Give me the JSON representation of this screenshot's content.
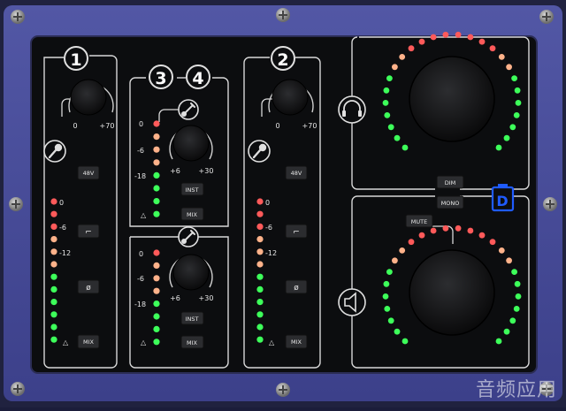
{
  "colors": {
    "chassis": "#4a4f9a",
    "panel": "#0c0d0f",
    "line": "#d8d8d8",
    "led_red": "#ff5a5a",
    "led_peach": "#ffb28a",
    "led_green": "#3dff5a",
    "logo_blue": "#1f5bff"
  },
  "channel_1": {
    "number": "1",
    "gain_min": "0",
    "gain_max": "+70",
    "meter_labels": [
      "0",
      "-6",
      "-12"
    ],
    "btn_phantom": "48V",
    "btn_highpass": "⌐",
    "btn_phase": "ø",
    "btn_mix": "MIX",
    "triangle": "△"
  },
  "channel_34": {
    "number_a": "3",
    "number_b": "4",
    "upper": {
      "meter_labels": [
        "0",
        "-6",
        "-18"
      ],
      "gain_min": "+6",
      "gain_max": "+30",
      "btn_inst": "INST",
      "btn_mix": "MIX",
      "triangle": "△"
    },
    "lower": {
      "meter_labels": [
        "0",
        "-6",
        "-18"
      ],
      "gain_min": "+6",
      "gain_max": "+30",
      "btn_inst": "INST",
      "btn_mix": "MIX",
      "triangle": "△"
    }
  },
  "channel_2": {
    "number": "2",
    "gain_min": "0",
    "gain_max": "+70",
    "meter_labels": [
      "0",
      "-6",
      "-12"
    ],
    "btn_phantom": "48V",
    "btn_highpass": "⌐",
    "btn_phase": "ø",
    "btn_mix": "MIX",
    "triangle": "△"
  },
  "monitor": {
    "btn_dim": "DIM",
    "btn_mono": "MONO",
    "btn_mute": "MUTE",
    "logo": "D"
  },
  "watermark": "音频应用"
}
